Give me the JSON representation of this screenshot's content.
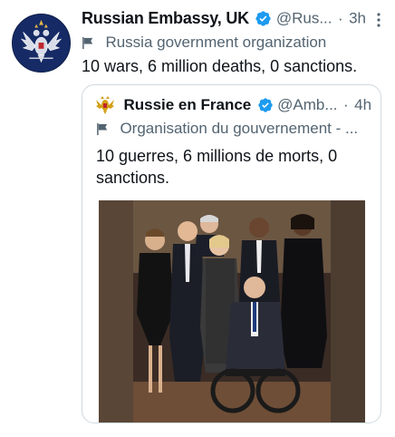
{
  "tweet": {
    "display_name": "Russian Embassy, UK",
    "handle": "@Rus...",
    "separator": "·",
    "time": "3h",
    "account_label": "Russia government organization",
    "text": "10 wars, 6 million deaths, 0 sanctions."
  },
  "quoted_tweet": {
    "display_name": "Russie en France",
    "handle": "@Amb...",
    "separator": "·",
    "time": "4h",
    "account_label": "Organisation du gouvernement - ...",
    "text": "10 guerres, 6 millions de morts, 0 sanctions."
  },
  "icons": {
    "verified": "verified-badge-icon",
    "more": "more-options-icon",
    "label": "flag-icon"
  },
  "colors": {
    "verified_blue": "#1d9bf0",
    "secondary_text": "#536471",
    "primary_text": "#0f1419",
    "border": "#cfd9de"
  }
}
